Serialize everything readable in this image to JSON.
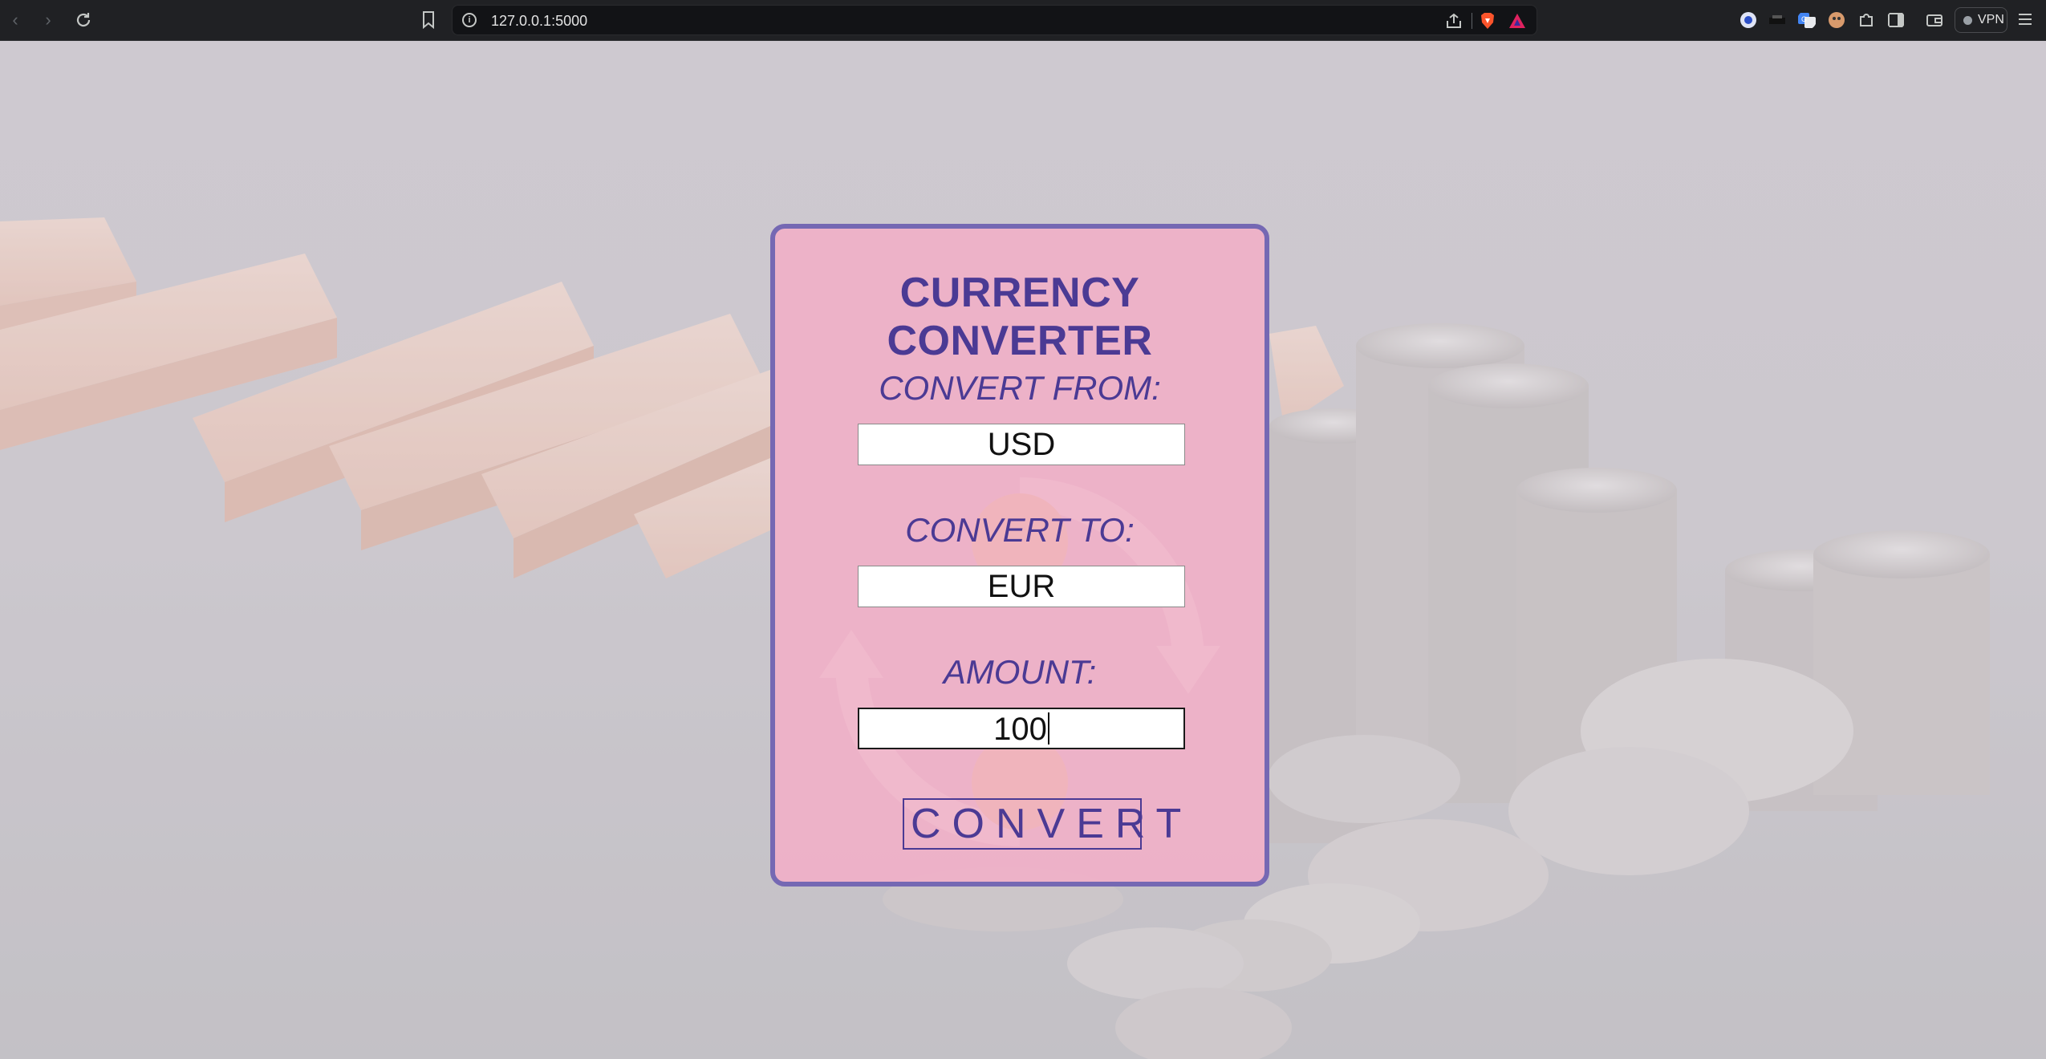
{
  "browser": {
    "url": "127.0.0.1:5000",
    "vpn_label": "VPN",
    "info_symbol": "i"
  },
  "converter": {
    "title": "CURRENCY CONVERTER",
    "from_label": "CONVERT FROM:",
    "from_value": "USD",
    "to_label": "CONVERT TO:",
    "to_value": "EUR",
    "amount_label": "AMOUNT:",
    "amount_value": "100",
    "button_label": "CONVERT"
  },
  "colors": {
    "card_border": "#7568b3",
    "card_fill": "#f0b0c8",
    "text_accent": "#4b3a94",
    "chrome": "#202124"
  },
  "icons": [
    "back-icon",
    "forward-icon",
    "reload-icon",
    "bookmark-icon",
    "site-info-icon",
    "share-icon",
    "brave-shield-icon",
    "brave-rewards-icon",
    "extension-icon",
    "sidebar-icon",
    "wallet-icon",
    "menu-icon"
  ]
}
